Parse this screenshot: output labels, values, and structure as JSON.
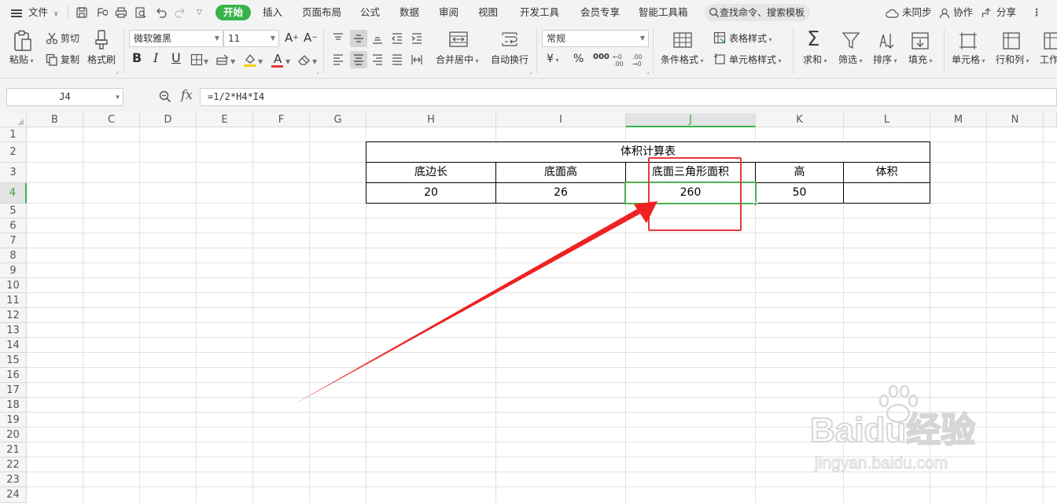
{
  "menubar": {
    "hamburger_label": "文件",
    "tabs": [
      "开始",
      "插入",
      "页面布局",
      "公式",
      "数据",
      "审阅",
      "视图",
      "开发工具",
      "会员专享",
      "智能工具箱"
    ],
    "active_tab_index": 0,
    "search_placeholder": "查找命令、搜索模板",
    "sync_label": "未同步",
    "collab_label": "协作",
    "share_label": "分享"
  },
  "ribbon": {
    "paste_label": "粘贴",
    "cut_label": "剪切",
    "copy_label": "复制",
    "format_painter_label": "格式刷",
    "font_name": "微软雅黑",
    "font_size": "11",
    "font_buttons": [
      "B",
      "I",
      "U"
    ],
    "merge_label": "合并居中",
    "wrap_label": "自动换行",
    "number_format": "常规",
    "number_symbols": [
      "¥",
      "%",
      "000"
    ],
    "table_style_label": "表格样式",
    "cond_format_label": "条件格式",
    "cell_style_label": "单元格样式",
    "sum_label": "求和",
    "filter_label": "筛选",
    "sort_label": "排序",
    "fill_label": "填充",
    "cell_label": "单元格",
    "rowcol_label": "行和列",
    "worksheet_label": "工作"
  },
  "formula_bar": {
    "name_box": "J4",
    "fx_label": "fx",
    "formula": "=1/2*H4*I4"
  },
  "sheet": {
    "columns": [
      "B",
      "C",
      "D",
      "E",
      "F",
      "G",
      "H",
      "I",
      "J",
      "K",
      "L",
      "M",
      "N"
    ],
    "rows": [
      "1",
      "2",
      "3",
      "4",
      "5",
      "6",
      "7",
      "8",
      "9",
      "10",
      "11",
      "12",
      "13",
      "14",
      "15",
      "16",
      "17",
      "18",
      "19",
      "20",
      "21",
      "22",
      "23",
      "24"
    ],
    "active_column": "J",
    "active_row": "4",
    "table": {
      "title": "体积计算表",
      "headers": [
        "底边长",
        "底面高",
        "底面三角形面积",
        "高",
        "体积"
      ],
      "values": [
        "20",
        "26",
        "260",
        "50",
        ""
      ]
    }
  },
  "annotation": {
    "highlight_color": "#e53935",
    "arrow_color": "#ee2222"
  },
  "watermark": {
    "brand": "Baidu经验",
    "url": "jingyan.baidu.com"
  },
  "colors": {
    "accent_green": "#37b34a",
    "selection_green": "#4caf50"
  }
}
